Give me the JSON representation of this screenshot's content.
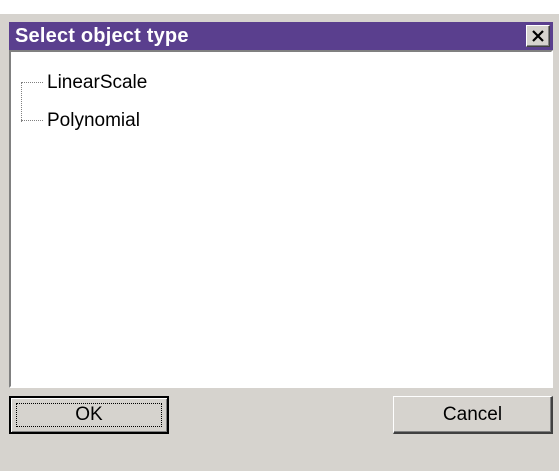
{
  "dialog": {
    "title": "Select object type",
    "close_icon": "close-icon",
    "tree": {
      "items": [
        {
          "label": "LinearScale"
        },
        {
          "label": "Polynomial"
        }
      ]
    },
    "buttons": {
      "ok_label": "OK",
      "cancel_label": "Cancel"
    },
    "colors": {
      "titlebar": "#5a3f8e",
      "face": "#d6d3ce"
    }
  }
}
